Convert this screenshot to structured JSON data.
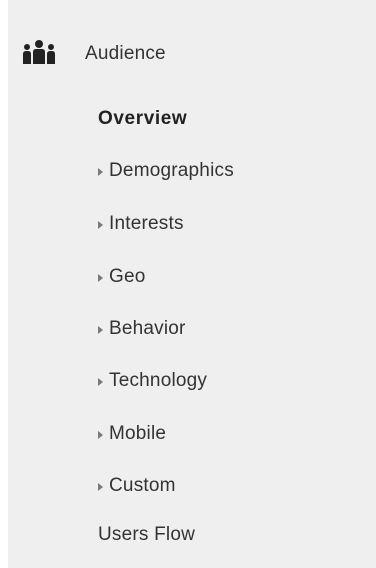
{
  "sidebar": {
    "section": {
      "label": "Audience",
      "icon": "audience-people-icon"
    },
    "items": [
      {
        "label": "Overview",
        "active": true,
        "expandable": false
      },
      {
        "label": "Demographics",
        "active": false,
        "expandable": true
      },
      {
        "label": "Interests",
        "active": false,
        "expandable": true
      },
      {
        "label": "Geo",
        "active": false,
        "expandable": true
      },
      {
        "label": "Behavior",
        "active": false,
        "expandable": true
      },
      {
        "label": "Technology",
        "active": false,
        "expandable": true
      },
      {
        "label": "Mobile",
        "active": false,
        "expandable": true
      },
      {
        "label": "Custom",
        "active": false,
        "expandable": true
      },
      {
        "label": "Users Flow",
        "active": false,
        "expandable": false
      }
    ]
  }
}
